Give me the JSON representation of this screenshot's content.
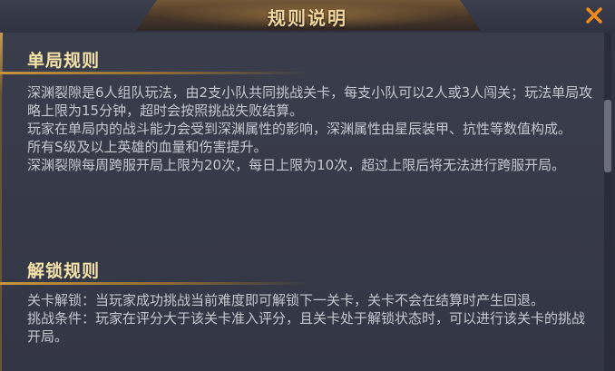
{
  "header": {
    "title": "规则说明",
    "close_icon": "close-icon"
  },
  "colors": {
    "title": "#f3d7a0",
    "section_title": "#f6e3a8",
    "body_text": "#c6c8d0",
    "accent": "#c7953e",
    "close": "#f08a1c"
  },
  "sections": [
    {
      "title": "单局规则",
      "paragraphs": [
        "深渊裂隙是6人组队玩法，由2支小队共同挑战关卡，每支小队可以2人或3人闯关；玩法单局攻略上限为15分钟，超时会按照挑战失败结算。",
        "玩家在单局内的战斗能力会受到深渊属性的影响，深渊属性由星辰装甲、抗性等数值构成。",
        "所有S级及以上英雄的血量和伤害提升。",
        "深渊裂隙每周跨服开局上限为20次，每日上限为10次，超过上限后将无法进行跨服开局。"
      ]
    },
    {
      "title": "解锁规则",
      "paragraphs": [
        "关卡解锁：当玩家成功挑战当前难度即可解锁下一关卡，关卡不会在结算时产生回退。",
        "挑战条件：玩家在评分大于该关卡准入评分，且关卡处于解锁状态时，可以进行该关卡的挑战开局。"
      ]
    }
  ]
}
